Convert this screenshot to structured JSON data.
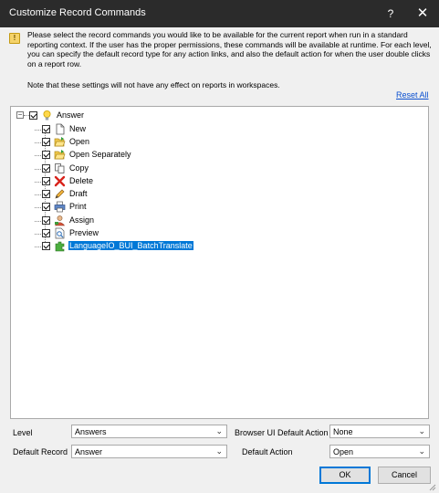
{
  "window": {
    "title": "Customize Record Commands",
    "help_label": "?",
    "close_label": "✕"
  },
  "info": {
    "message": "Please select the record commands you would like to be available for the current report when run in a standard reporting context. If the user has the proper permissions, these commands will be available at runtime. For each level, you can specify the default record type for any action links, and also the default action for when the user double clicks on a report row.",
    "note": "Note that these settings will not have any effect on reports in workspaces.",
    "icon": "warning-icon"
  },
  "reset_label": "Reset All",
  "tree": {
    "root": {
      "label": "Answer",
      "icon": "lightbulb-icon",
      "checked": true
    },
    "items": [
      {
        "label": "New",
        "icon": "new-document-icon",
        "checked": true
      },
      {
        "label": "Open",
        "icon": "open-folder-icon",
        "checked": true
      },
      {
        "label": "Open Separately",
        "icon": "open-folder-icon",
        "checked": true
      },
      {
        "label": "Copy",
        "icon": "copy-icon",
        "checked": true
      },
      {
        "label": "Delete",
        "icon": "delete-x-icon",
        "checked": true
      },
      {
        "label": "Draft",
        "icon": "pencil-icon",
        "checked": true
      },
      {
        "label": "Print",
        "icon": "printer-icon",
        "checked": true
      },
      {
        "label": "Assign",
        "icon": "assign-user-icon",
        "checked": true
      },
      {
        "label": "Preview",
        "icon": "preview-icon",
        "checked": true
      },
      {
        "label": "LanguageIO_BUI_BatchTranslate",
        "icon": "plugin-icon",
        "checked": true,
        "selected": true
      }
    ]
  },
  "fields": {
    "level_label": "Level",
    "level_value": "Answers",
    "bui_action_label": "Browser UI Default Action",
    "bui_action_value": "None",
    "default_record_label": "Default Record",
    "default_record_value": "Answer",
    "default_action_label": "Default Action",
    "default_action_value": "Open"
  },
  "buttons": {
    "ok": "OK",
    "cancel": "Cancel"
  },
  "colors": {
    "titlebar": "#2b2b2b",
    "selection": "#0078d7",
    "link": "#0a4fd0"
  }
}
